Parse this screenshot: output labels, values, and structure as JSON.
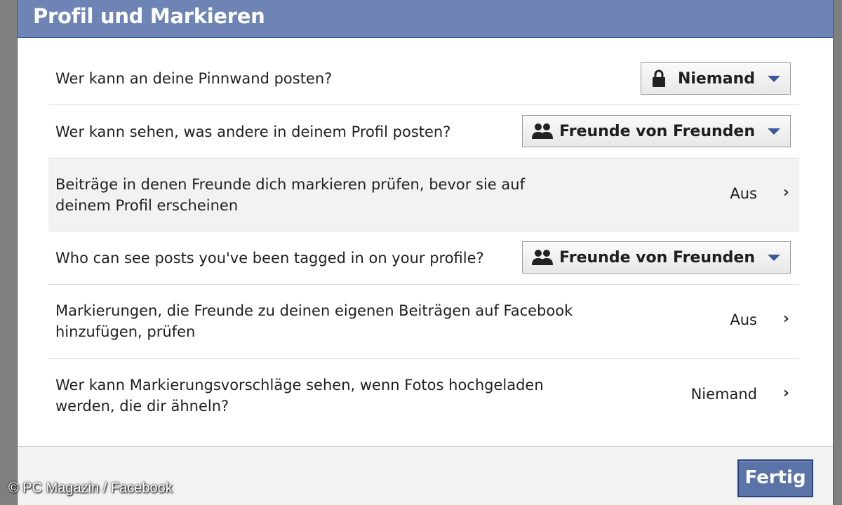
{
  "dialog": {
    "title": "Profil und Markieren",
    "colors": {
      "header": "#6d84b4",
      "button": "#5b74a8"
    }
  },
  "rows": [
    {
      "label_lines": [
        "Wer kann an deine Pinnwand posten?"
      ],
      "control": "dropdown",
      "icon": "lock-icon",
      "value": "Niemand"
    },
    {
      "label_lines": [
        "Wer kann sehen, was andere in deinem Profil posten?"
      ],
      "control": "dropdown",
      "icon": "friends-icon",
      "value": "Freunde von Freunden"
    },
    {
      "label_lines": [
        "Beiträge in denen Freunde dich markieren prüfen, bevor sie auf",
        "deinem Profil erscheinen"
      ],
      "control": "link",
      "value": "Aus"
    },
    {
      "label_lines": [
        "Who can see posts you've been tagged in on your profile?"
      ],
      "control": "dropdown",
      "icon": "friends-icon",
      "value": "Freunde von Freunden"
    },
    {
      "label_lines": [
        "Markierungen, die Freunde zu deinen eigenen Beiträgen auf Facebook",
        "hinzufügen, prüfen"
      ],
      "control": "link",
      "value": "Aus"
    },
    {
      "label_lines": [
        "Wer kann Markierungsvorschläge sehen, wenn Fotos hochgeladen",
        "werden, die dir ähneln?"
      ],
      "control": "link",
      "value": "Niemand"
    }
  ],
  "footer": {
    "done_label": "Fertig"
  },
  "watermark": "© PC Magazin / Facebook"
}
